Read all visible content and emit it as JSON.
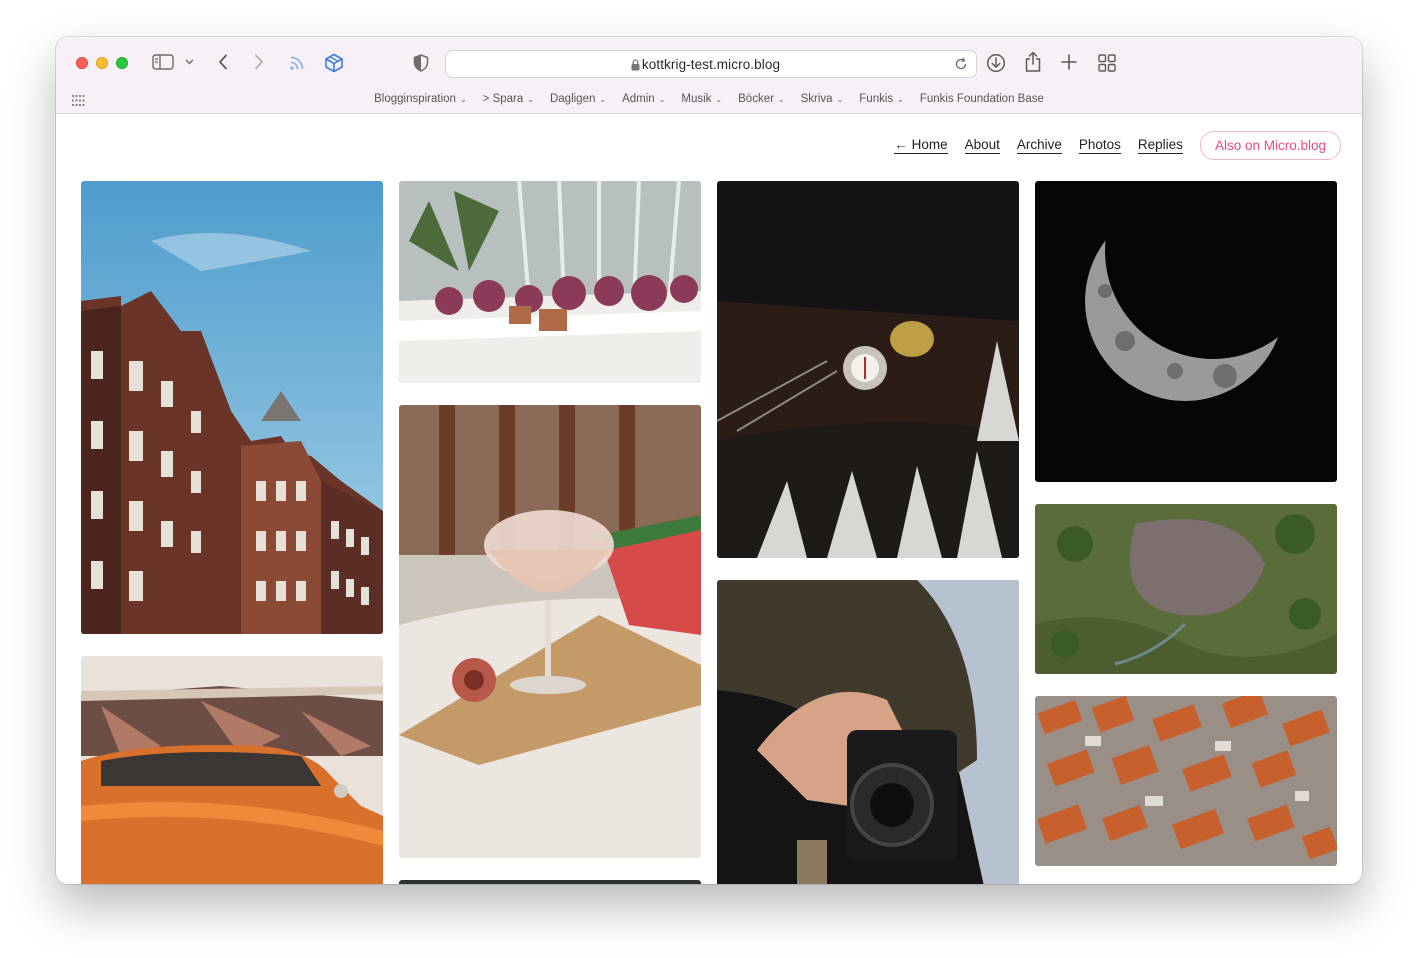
{
  "browser": {
    "url": "kottkrig-test.micro.blog",
    "bookmarks": [
      {
        "label": "Blogginspiration",
        "has_menu": true
      },
      {
        "label": "> Spara",
        "has_menu": true
      },
      {
        "label": "Dagligen",
        "has_menu": true
      },
      {
        "label": "Admin",
        "has_menu": true
      },
      {
        "label": "Musik",
        "has_menu": true
      },
      {
        "label": "Böcker",
        "has_menu": true
      },
      {
        "label": "Skriva",
        "has_menu": true
      },
      {
        "label": "Funkis",
        "has_menu": true
      },
      {
        "label": "Funkis Foundation Base",
        "has_menu": false
      }
    ],
    "toolbar_icons": [
      "sidebar-icon",
      "chevron-down-icon",
      "back-icon",
      "forward-icon",
      "rss-icon",
      "cube-icon",
      "shield-icon",
      "download-icon",
      "share-icon",
      "new-tab-icon",
      "tab-overview-icon"
    ]
  },
  "site": {
    "nav": {
      "home": "← Home",
      "about": "About",
      "archive": "Archive",
      "photos": "Photos",
      "replies": "Replies",
      "also": "Also on Micro.blog"
    },
    "accent_color": "#e44d7e",
    "photos": [
      {
        "subject": "brick-buildings-blue-sky"
      },
      {
        "subject": "greenhouse-plants"
      },
      {
        "subject": "compass-on-table"
      },
      {
        "subject": "crescent-moon"
      },
      {
        "subject": "aerial-green-landscape"
      },
      {
        "subject": "orange-vintage-car"
      },
      {
        "subject": "cocktail-glass-watermelon"
      },
      {
        "subject": "hand-holding-pentax-camera"
      },
      {
        "subject": "aerial-orange-rooftops"
      },
      {
        "subject": "dark-photo-partial"
      }
    ]
  }
}
